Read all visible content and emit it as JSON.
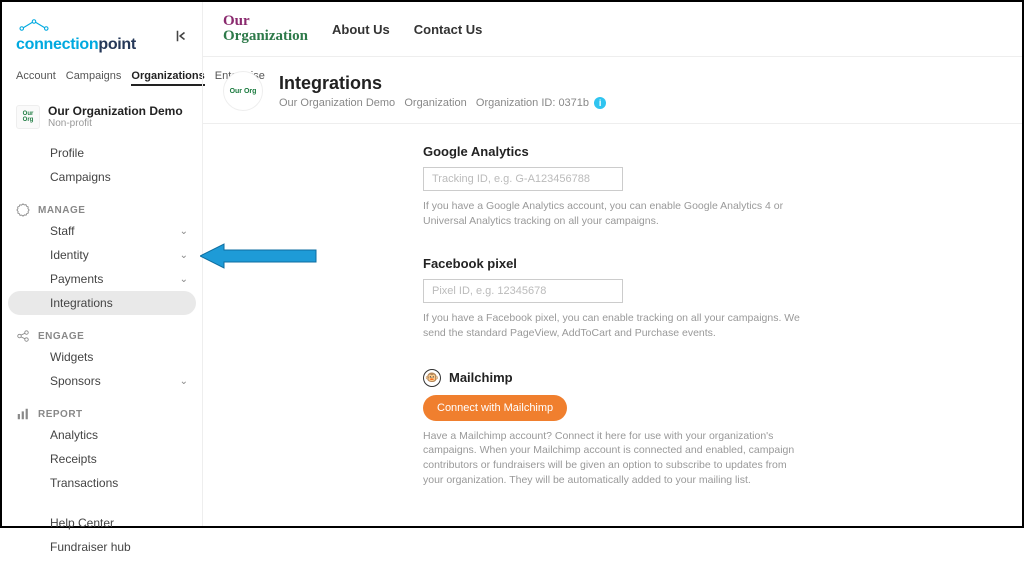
{
  "logo": {
    "left": "connection",
    "right": "point"
  },
  "topTabs": {
    "account": "Account",
    "campaigns": "Campaigns",
    "organizations": "Organizations",
    "enterprise": "Enterprise"
  },
  "org": {
    "name": "Our Organization Demo",
    "type": "Non-profit",
    "avatar": "Our Org"
  },
  "nav": {
    "basic": {
      "profile": "Profile",
      "campaigns": "Campaigns"
    },
    "manage": {
      "head": "MANAGE",
      "staff": "Staff",
      "identity": "Identity",
      "payments": "Payments",
      "integrations": "Integrations"
    },
    "engage": {
      "head": "ENGAGE",
      "widgets": "Widgets",
      "sponsors": "Sponsors"
    },
    "report": {
      "head": "REPORT",
      "analytics": "Analytics",
      "receipts": "Receipts",
      "transactions": "Transactions"
    },
    "footer": {
      "help": "Help Center",
      "hub": "Fundraiser hub"
    }
  },
  "topbar": {
    "brand1": "Our",
    "brand2": "Organization",
    "about": "About Us",
    "contact": "Contact Us"
  },
  "page": {
    "title": "Integrations",
    "crumb1": "Our Organization Demo",
    "crumb2": "Organization",
    "crumb3_label": "Organization ID:",
    "crumb3_value": "0371b"
  },
  "sections": {
    "ga": {
      "title": "Google Analytics",
      "placeholder": "Tracking ID, e.g. G-A123456788",
      "desc": "If you have a Google Analytics account, you can enable Google Analytics 4 or Universal Analytics tracking on all your campaigns."
    },
    "fb": {
      "title": "Facebook pixel",
      "placeholder": "Pixel ID, e.g. 12345678",
      "desc": "If you have a Facebook pixel, you can enable tracking on all your campaigns. We send the standard PageView, AddToCart and Purchase events."
    },
    "mc": {
      "title": "Mailchimp",
      "button": "Connect with Mailchimp",
      "desc": "Have a Mailchimp account? Connect it here for use with your organization's campaigns. When your Mailchimp account is connected and enabled, campaign contributors or fundraisers will be given an option to subscribe to updates from your organization. They will be automatically added to your mailing list."
    }
  }
}
